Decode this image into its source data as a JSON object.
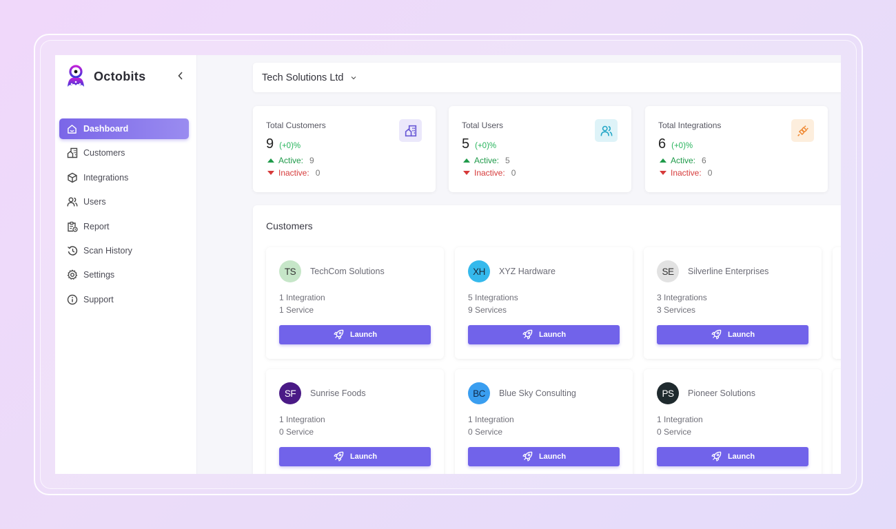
{
  "brand": {
    "name": "Octobits"
  },
  "sidebar": {
    "items": [
      {
        "label": "Dashboard",
        "icon": "home-icon",
        "active": true
      },
      {
        "label": "Customers",
        "icon": "building-icon",
        "active": false
      },
      {
        "label": "Integrations",
        "icon": "cube-icon",
        "active": false
      },
      {
        "label": "Users",
        "icon": "users-icon",
        "active": false
      },
      {
        "label": "Report",
        "icon": "report-icon",
        "active": false
      },
      {
        "label": "Scan History",
        "icon": "history-icon",
        "active": false
      },
      {
        "label": "Settings",
        "icon": "gear-icon",
        "active": false
      },
      {
        "label": "Support",
        "icon": "info-icon",
        "active": false
      }
    ]
  },
  "org_selector": {
    "value": "Tech Solutions Ltd"
  },
  "stats": [
    {
      "title": "Total Customers",
      "value": "9",
      "change": "(+0)%",
      "active_label": "Active:",
      "active": "9",
      "inactive_label": "Inactive:",
      "inactive": "0",
      "icon": "building-icon",
      "icon_color": "#6a5ad6",
      "icon_bg": "#ebe8fb"
    },
    {
      "title": "Total Users",
      "value": "5",
      "change": "(+0)%",
      "active_label": "Active:",
      "active": "5",
      "inactive_label": "Inactive:",
      "inactive": "0",
      "icon": "users-icon",
      "icon_color": "#22a6c6",
      "icon_bg": "#def3f8"
    },
    {
      "title": "Total Integrations",
      "value": "6",
      "change": "(+0)%",
      "active_label": "Active:",
      "active": "6",
      "inactive_label": "Inactive:",
      "inactive": "0",
      "icon": "plug-icon",
      "icon_color": "#ef8a35",
      "icon_bg": "#fdeedd"
    }
  ],
  "customers": {
    "title": "Customers",
    "launch_label": "Launch",
    "items": [
      {
        "initials": "TS",
        "name": "TechCom Solutions",
        "integrations": "1 Integration",
        "services": "1 Service",
        "avatar_bg": "#c6e6c8",
        "avatar_fg": "#333333"
      },
      {
        "initials": "XH",
        "name": "XYZ Hardware",
        "integrations": "5 Integrations",
        "services": "9 Services",
        "avatar_bg": "#35b9ec",
        "avatar_fg": "#1a2a3a"
      },
      {
        "initials": "SE",
        "name": "Silverline Enterprises",
        "integrations": "3 Integrations",
        "services": "3 Services",
        "avatar_bg": "#e2e2e2",
        "avatar_fg": "#333333"
      },
      {
        "initials": "SF",
        "name": "Sunrise Foods",
        "integrations": "1 Integration",
        "services": "0 Service",
        "avatar_bg": "#4a1a86",
        "avatar_fg": "#ffffff"
      },
      {
        "initials": "BC",
        "name": "Blue Sky Consulting",
        "integrations": "1 Integration",
        "services": "0 Service",
        "avatar_bg": "#3a9ef0",
        "avatar_fg": "#0f2a4a"
      },
      {
        "initials": "PS",
        "name": "Pioneer Solutions",
        "integrations": "1 Integration",
        "services": "0 Service",
        "avatar_bg": "#1f2a2e",
        "avatar_fg": "#ffffff"
      }
    ]
  }
}
